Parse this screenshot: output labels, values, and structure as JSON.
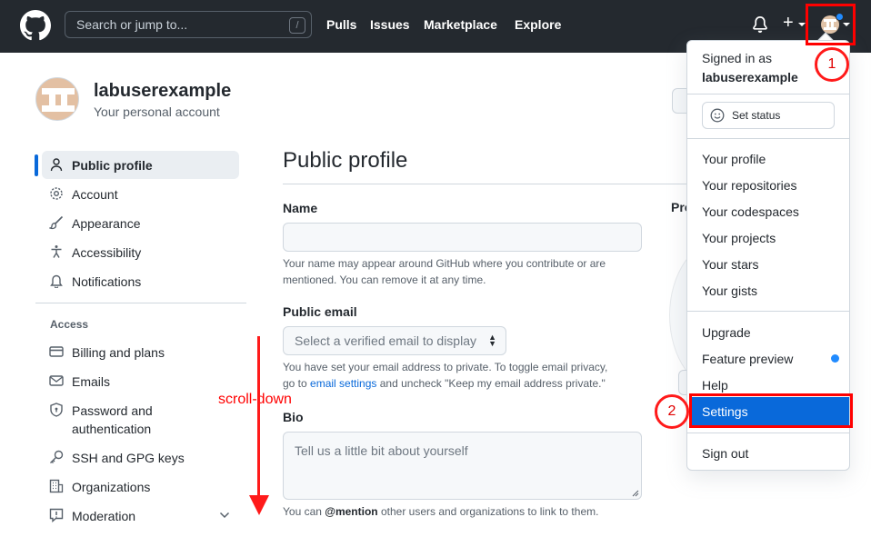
{
  "header": {
    "search_placeholder": "Search or jump to...",
    "search_shortcut": "/",
    "nav": [
      "Pulls",
      "Issues",
      "Marketplace",
      "Explore"
    ],
    "colors": {
      "background": "#24292f",
      "notification_dot": "#218bff"
    }
  },
  "account": {
    "username": "labuserexample",
    "subtitle": "Your personal account"
  },
  "sidebar": {
    "items": [
      {
        "label": "Public profile",
        "icon": "person-icon",
        "active": true
      },
      {
        "label": "Account",
        "icon": "gear-icon"
      },
      {
        "label": "Appearance",
        "icon": "paintbrush-icon"
      },
      {
        "label": "Accessibility",
        "icon": "accessibility-icon"
      },
      {
        "label": "Notifications",
        "icon": "bell-icon"
      }
    ],
    "section_label": "Access",
    "access_items": [
      {
        "label": "Billing and plans",
        "icon": "credit-card-icon"
      },
      {
        "label": "Emails",
        "icon": "mail-icon"
      },
      {
        "label": "Password and authentication",
        "label_line1": "Password and",
        "label_line2": "authentication",
        "icon": "shield-lock-icon"
      },
      {
        "label": "SSH and GPG keys",
        "icon": "key-icon"
      },
      {
        "label": "Organizations",
        "icon": "organization-icon"
      },
      {
        "label": "Moderation",
        "icon": "report-icon"
      }
    ]
  },
  "main": {
    "title": "Public profile",
    "name_label": "Name",
    "name_value": "",
    "name_note": "Your name may appear around GitHub where you contribute or are mentioned. You can remove it at any time.",
    "name_note_line1": "Your name may appear around GitHub where you contribute or are",
    "name_note_line2": "mentioned. You can remove it at any time.",
    "email_label": "Public email",
    "email_select": "Select a verified email to display",
    "email_note_line1": "You have set your email address to private. To toggle email privacy,",
    "email_note_pre": "go to ",
    "email_note_link": "email settings",
    "email_note_post": " and uncheck \"Keep my email address private.\"",
    "bio_label": "Bio",
    "bio_placeholder": "Tell us a little bit about yourself",
    "bio_note_pre": "You can ",
    "bio_note_mention": "@mention",
    "bio_note_post": " other users and organizations to link to them.",
    "profile_picture_label_partial": "Pro"
  },
  "dropdown": {
    "signed_in_as": "Signed in as",
    "username": "labuserexample",
    "set_status": "Set status",
    "group1": [
      "Your profile",
      "Your repositories",
      "Your codespaces",
      "Your projects",
      "Your stars",
      "Your gists"
    ],
    "group2": [
      "Upgrade",
      "Feature preview",
      "Help",
      "Settings"
    ],
    "sign_out": "Sign out",
    "highlight_color": "#0969da"
  },
  "annotations": {
    "step1": "1",
    "step2": "2",
    "scroll_label": "scroll-down",
    "color": "#ff0000"
  }
}
